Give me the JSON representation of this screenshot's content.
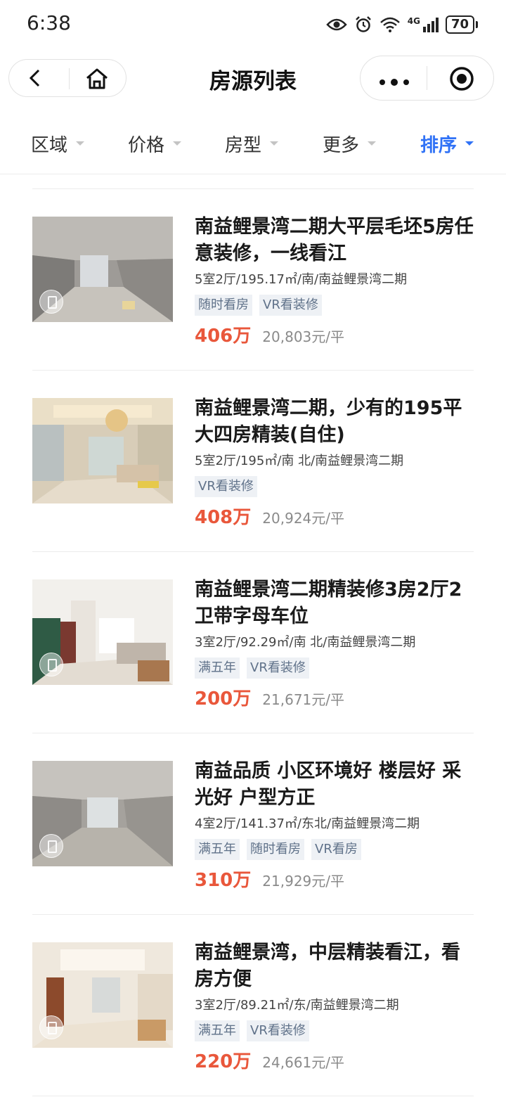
{
  "status_bar": {
    "time": "6:38",
    "network": "4G",
    "battery": "70"
  },
  "nav": {
    "title": "房源列表",
    "back_icon": "chevron-left-icon",
    "home_icon": "home-icon",
    "more_icon": "more-dots-icon",
    "close_icon": "target-close-icon"
  },
  "filters": [
    {
      "label": "区域",
      "active": false
    },
    {
      "label": "价格",
      "active": false
    },
    {
      "label": "房型",
      "active": false
    },
    {
      "label": "更多",
      "active": false
    },
    {
      "label": "排序",
      "active": true
    }
  ],
  "colors": {
    "accent_blue": "#3072f6",
    "price_red": "#e9573b",
    "tag_bg": "#eef1f5",
    "tag_text": "#5f7189"
  },
  "listings": [
    {
      "title": "南益鲤景湾二期大平层毛坯5房任意装修，一线看江",
      "specs": "5室2厅/195.17㎡/南/南益鲤景湾二期",
      "tags": [
        "随时看房",
        "VR看装修"
      ],
      "price": "406万",
      "unit_price": "20,803元/平"
    },
    {
      "title": "南益鲤景湾二期，少有的195平大四房精装(自住)",
      "specs": "5室2厅/195㎡/南 北/南益鲤景湾二期",
      "tags": [
        "VR看装修"
      ],
      "price": "408万",
      "unit_price": "20,924元/平"
    },
    {
      "title": "南益鲤景湾二期精装修3房2厅2卫带字母车位",
      "specs": "3室2厅/92.29㎡/南 北/南益鲤景湾二期",
      "tags": [
        "满五年",
        "VR看装修"
      ],
      "price": "200万",
      "unit_price": "21,671元/平"
    },
    {
      "title": "南益品质 小区环境好 楼层好 采光好 户型方正",
      "specs": "4室2厅/141.37㎡/东北/南益鲤景湾二期",
      "tags": [
        "满五年",
        "随时看房",
        "VR看房"
      ],
      "price": "310万",
      "unit_price": "21,929元/平"
    },
    {
      "title": "南益鲤景湾，中层精装看江，看房方便",
      "specs": "3室2厅/89.21㎡/东/南益鲤景湾二期",
      "tags": [
        "满五年",
        "VR看装修"
      ],
      "price": "220万",
      "unit_price": "24,661元/平"
    }
  ]
}
